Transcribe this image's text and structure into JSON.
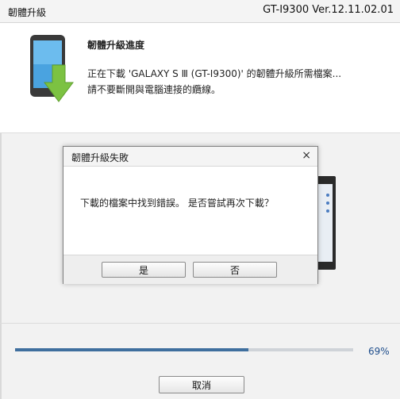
{
  "window": {
    "title": "韌體升級",
    "model_version": "GT-I9300 Ver.12.11.02.01"
  },
  "header": {
    "title": "韌體升級進度",
    "line1": "正在下載 'GALAXY S Ⅲ (GT-I9300)' 的韌體升級所需檔案...",
    "line2": "請不要斷開與電腦連接的纜線。",
    "icon": "phone-download-icon"
  },
  "progress": {
    "percent": 69,
    "label": "69%"
  },
  "cancel_label": "取消",
  "dialog": {
    "title": "韌體升級失敗",
    "close_glyph": "×",
    "message": "下載的檔案中找到錯誤。 是否嘗試再次下載？",
    "yes_label": "是",
    "no_label": "否"
  },
  "colors": {
    "progress_fill": "#3f6f9e",
    "progress_track": "#cfd3d8",
    "arrow_green": "#7cc242",
    "phone_body": "#3a3a3a",
    "phone_screen": "#4aa3e0"
  }
}
